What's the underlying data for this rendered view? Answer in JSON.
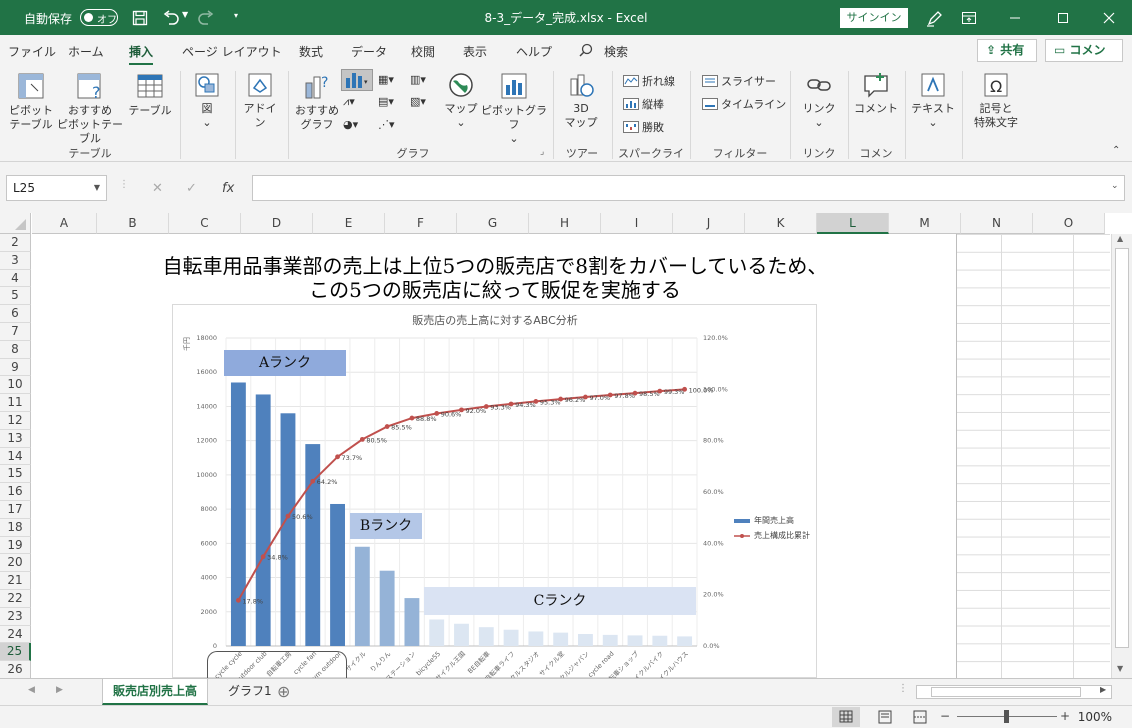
{
  "titlebar": {
    "autosave_label": "自動保存",
    "autosave_state": "オフ",
    "document_title": "8-3_データ_完成.xlsx",
    "title_sep": "-",
    "app_name": "Excel",
    "signin_label": "サインイン",
    "undo_icon": "undo-icon",
    "redo_icon": "redo-icon"
  },
  "tabs": [
    "ファイル",
    "ホーム",
    "挿入",
    "ページ レイアウト",
    "数式",
    "データ",
    "校閲",
    "表示",
    "ヘルプ"
  ],
  "active_tab": "挿入",
  "search_label": "検索",
  "share_label": "共有",
  "comment_label": "コメント",
  "ribbon": {
    "table_group": {
      "label": "テーブル",
      "pivot_l1": "ピボット",
      "pivot_l2": "テーブル",
      "rec_pivot_l1": "おすすめ",
      "rec_pivot_l2": "ピボットテーブル",
      "table": "テーブル"
    },
    "illustrations": {
      "label": "図"
    },
    "addins": {
      "l1": "アドイ",
      "l2": "ン"
    },
    "graph_group": {
      "label": "グラフ",
      "rec_l1": "おすすめ",
      "rec_l2": "グラフ",
      "map": "マップ",
      "pivot_chart": "ピボットグラフ"
    },
    "tour_group": {
      "label": "ツアー",
      "l1": "3D",
      "l2": "マップ"
    },
    "sparkline_group": {
      "label": "スパークライン",
      "line": "折れ線",
      "column": "縦棒",
      "winloss": "勝敗"
    },
    "filter_group": {
      "label": "フィルター",
      "slicer": "スライサー",
      "timeline": "タイムライン"
    },
    "link_group": {
      "label": "リンク",
      "link": "リンク"
    },
    "comment_group": {
      "label": "コメント",
      "comment": "コメント"
    },
    "text_group": {
      "text": "テキスト"
    },
    "symbol_group": {
      "l1": "記号と",
      "l2": "特殊文字"
    }
  },
  "formula_bar": {
    "name_box": "L25",
    "fx": "fx",
    "formula": ""
  },
  "columns": [
    "A",
    "B",
    "C",
    "D",
    "E",
    "F",
    "G",
    "H",
    "I",
    "J",
    "K",
    "L",
    "M",
    "N",
    "O"
  ],
  "selected_column": "L",
  "rows": [
    "2",
    "3",
    "4",
    "5",
    "6",
    "7",
    "8",
    "9",
    "10",
    "11",
    "12",
    "13",
    "14",
    "15",
    "16",
    "17",
    "18",
    "19",
    "20",
    "21",
    "22",
    "23",
    "24",
    "25",
    "26"
  ],
  "selected_row": "25",
  "headline": {
    "line1": "自転車用品事業部の売上は上位5つの販売店で8割をカバーしているため、",
    "line2": "この5つの販売店に絞って販促を実施する"
  },
  "ranks": {
    "a": "Aランク",
    "b": "Bランク",
    "c": "Cランク"
  },
  "chart_data": {
    "type": "bar",
    "title": "販売店の売上高に対するABC分析",
    "ylabel": "千円",
    "ylim": [
      0,
      18000
    ],
    "y2lim": [
      0,
      120
    ],
    "yticks": [
      "0",
      "2000",
      "4000",
      "6000",
      "8000",
      "10000",
      "12000",
      "14000",
      "16000",
      "18000"
    ],
    "y2ticks": [
      "0.0%",
      "20.0%",
      "40.0%",
      "60.0%",
      "80.0%",
      "100.0%",
      "120.0%"
    ],
    "categories": [
      "cycle cycle",
      "outdoor club",
      "自転車工房",
      "cycle fan",
      "gym outdoor",
      "サイクル",
      "りんりん",
      "ステーション",
      "bicycle55",
      "サイクル王国",
      "BE自転車",
      "自転車ライフ",
      "サイクルスタジオ",
      "サイクル堂",
      "サイクルジャパン",
      "cycle road",
      "自転車ショップ",
      "サイクルバイク",
      "サイクルハウス"
    ],
    "series": [
      {
        "name": "年間売上高",
        "type": "bar",
        "color": "#4f81bd",
        "values": [
          15400,
          14700,
          13600,
          11800,
          8300,
          5800,
          4400,
          2800,
          1550,
          1300,
          1100,
          950,
          850,
          780,
          700,
          650,
          620,
          600,
          560
        ]
      },
      {
        "name": "売上構成比累計",
        "type": "line",
        "axis": "secondary",
        "color": "#c0504d",
        "values": [
          17.8,
          34.8,
          50.6,
          64.2,
          73.7,
          80.5,
          85.5,
          88.8,
          90.6,
          92.0,
          93.3,
          94.3,
          95.3,
          96.2,
          97.0,
          97.8,
          98.5,
          99.3,
          100.0
        ]
      }
    ]
  },
  "sheets": [
    "販売店別売上高",
    "グラフ1"
  ],
  "active_sheet": "販売店別売上高",
  "zoom_label": "100%"
}
